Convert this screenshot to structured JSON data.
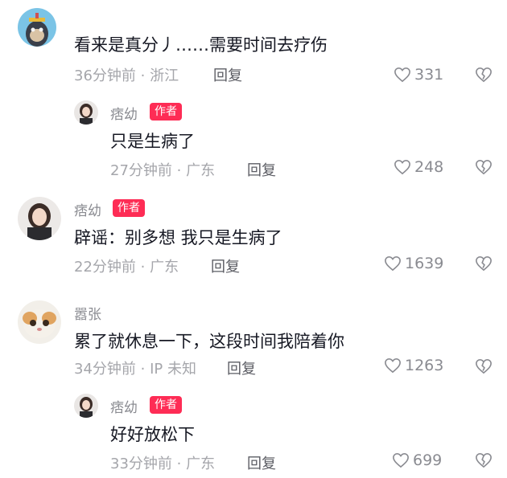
{
  "comments": [
    {
      "name": "",
      "text": "看来是真分丿……需要时间去疗伤",
      "meta": "36分钟前 · 浙江",
      "reply": "回复",
      "likes": "331",
      "avatar": "ape-avatar"
    },
    {
      "name": "痞幼",
      "badge": "作者",
      "text": "只是生病了",
      "meta": "27分钟前 · 广东",
      "reply": "回复",
      "likes": "248",
      "avatar": "girl-avatar"
    },
    {
      "name": "痞幼",
      "badge": "作者",
      "text": "辟谣：别多想 我只是生病了",
      "meta": "22分钟前 · 广东",
      "reply": "回复",
      "likes": "1639",
      "avatar": "girl-avatar"
    },
    {
      "name": "嚣张",
      "text": "累了就休息一下，这段时间我陪着你",
      "meta": "34分钟前 · IP 未知",
      "reply": "回复",
      "likes": "1263",
      "avatar": "cat-avatar"
    },
    {
      "name": "痞幼",
      "badge": "作者",
      "text": "好好放松下",
      "meta": "33分钟前 · 广东",
      "reply": "回复",
      "likes": "699",
      "avatar": "girl-avatar"
    }
  ],
  "colors": {
    "badge": "#fe2c55",
    "meta": "#a5a6ab",
    "name": "#8a8b91"
  }
}
